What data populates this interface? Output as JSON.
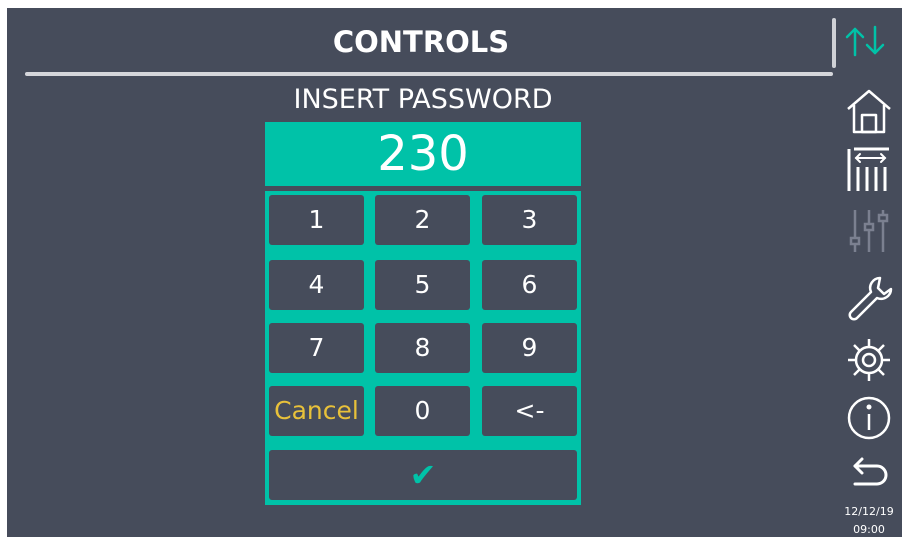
{
  "header": {
    "title": "CONTROLS",
    "scroll_icon": "up-down-arrows-icon"
  },
  "password_dialog": {
    "prompt": "INSERT PASSWORD",
    "entered_value": "230",
    "keys": [
      "1",
      "2",
      "3",
      "4",
      "5",
      "6",
      "7",
      "8",
      "9",
      "Cancel",
      "0",
      "<-"
    ],
    "confirm_label": "✔"
  },
  "sidebar": {
    "icons": [
      "home-icon",
      "bar-levels-icon",
      "sliders-icon",
      "wrench-icon",
      "gear-icon",
      "info-icon",
      "back-arrow-icon"
    ]
  },
  "status": {
    "date": "12/12/19",
    "time": "09:00"
  },
  "colors": {
    "background": "#464c5b",
    "accent": "#00c2a8",
    "cancel_text": "#e8c13a",
    "disabled_icon": "#7b8090"
  }
}
